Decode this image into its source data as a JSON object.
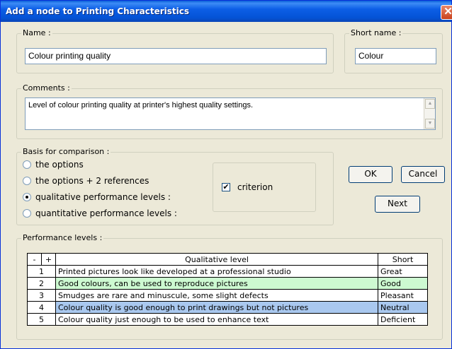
{
  "window": {
    "title": "Add a node to Printing Characteristics",
    "close_glyph": "✕"
  },
  "name": {
    "label": "Name :",
    "value": "Colour printing quality"
  },
  "short_name": {
    "label": "Short name :",
    "value": "Colour"
  },
  "comments": {
    "label": "Comments :",
    "value": "Level of colour printing quality at printer's highest quality settings."
  },
  "basis": {
    "label": "Basis for comparison :",
    "options": [
      {
        "label": "the options",
        "checked": false
      },
      {
        "label": "the options + 2 references",
        "checked": false
      },
      {
        "label": "qualitative performance levels :",
        "checked": true
      },
      {
        "label": "quantitative performance levels :",
        "checked": false
      }
    ],
    "criterion": {
      "label": "criterion",
      "checked": true,
      "glyph": "✔"
    }
  },
  "buttons": {
    "ok": "OK",
    "cancel": "Cancel",
    "next": "Next"
  },
  "performance": {
    "label": "Performance levels :",
    "headers": {
      "minus": "-",
      "plus": "+",
      "level": "Qualitative level",
      "short": "Short"
    },
    "rows": [
      {
        "num": "1",
        "level": "Printed pictures look like developed at a professional studio",
        "short": "Great"
      },
      {
        "num": "2",
        "level": "Good colours, can be used to reproduce pictures",
        "short": "Good"
      },
      {
        "num": "3",
        "level": "Smudges are rare and minuscule, some slight defects",
        "short": "Pleasant"
      },
      {
        "num": "4",
        "level": "Colour quality is good enough to print drawings but not pictures",
        "short": "Neutral"
      },
      {
        "num": "5",
        "level": "Colour quality just enough to be used to enhance text",
        "short": "Deficient"
      }
    ]
  },
  "colors": {
    "title_bar": "#0c5ee6",
    "row_good": "#cdfad1",
    "row_neutral": "#a9c8ef"
  }
}
